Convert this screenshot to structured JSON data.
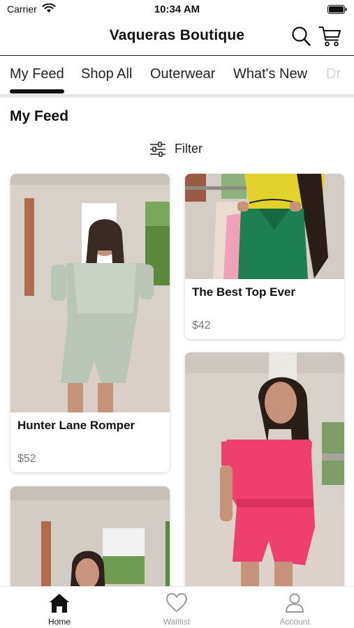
{
  "status_bar": {
    "carrier": "Carrier",
    "time": "10:34 AM"
  },
  "header": {
    "title": "Vaqueras Boutique"
  },
  "tabs": [
    {
      "label": "My Feed"
    },
    {
      "label": "Shop All"
    },
    {
      "label": "Outerwear"
    },
    {
      "label": "What's New"
    },
    {
      "label": "Dr"
    }
  ],
  "section": {
    "title": "My Feed"
  },
  "filter": {
    "label": "Filter"
  },
  "products": [
    {
      "name": "Hunter Lane Romper",
      "price": "$52"
    },
    {
      "name": "The Best Top Ever",
      "price": "$42"
    },
    {
      "name": "",
      "price": ""
    },
    {
      "name": "",
      "price": ""
    }
  ],
  "bottom_nav": [
    {
      "label": "Home",
      "icon": "home-icon",
      "active": true
    },
    {
      "label": "Waitlist",
      "icon": "heart-icon",
      "active": false
    },
    {
      "label": "Account",
      "icon": "account-icon",
      "active": false
    }
  ],
  "colors": {
    "text": "#111111",
    "price": "#777777",
    "nav_active": "#111111",
    "nav_inactive": "#9a9a9a",
    "divider": "#e6e6e6"
  }
}
